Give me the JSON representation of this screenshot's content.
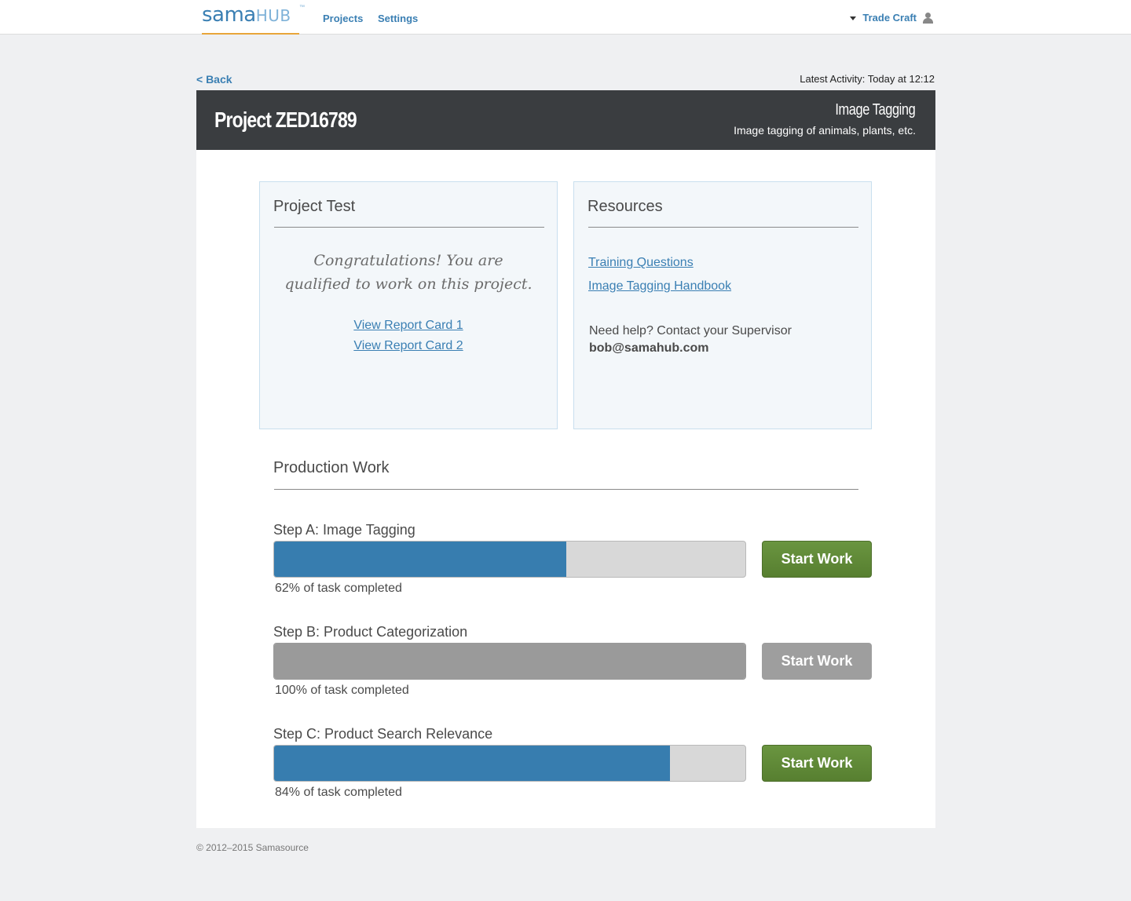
{
  "nav": {
    "logo_sama": "sama",
    "logo_hub": "HUB",
    "logo_tm": "™",
    "projects": "Projects",
    "settings": "Settings",
    "user": "Trade Craft"
  },
  "subheader": {
    "back": "< Back",
    "latest_activity": "Latest Activity: Today at 12:12"
  },
  "banner": {
    "title": "Project ZED16789",
    "type": "Image Tagging",
    "description": "Image tagging of animals, plants, etc."
  },
  "project_test": {
    "heading": "Project Test",
    "message_line1": "Congratulations! You are",
    "message_line2": "qualified to work on this project.",
    "report_links": [
      "View Report Card 1",
      "View Report Card 2"
    ]
  },
  "resources": {
    "heading": "Resources",
    "links": [
      "Training Questions",
      "Image Tagging Handbook"
    ],
    "help_text": "Need help? Contact your Supervisor",
    "email": "bob@samahub.com"
  },
  "production": {
    "heading": "Production Work",
    "steps": [
      {
        "label": "Step A: Image Tagging",
        "progress": 62,
        "progress_text": "62% of task completed",
        "button": "Start Work",
        "enabled": true
      },
      {
        "label": "Step B: Product Categorization",
        "progress": 100,
        "progress_text": "100% of task completed",
        "button": "Start Work",
        "enabled": false
      },
      {
        "label": "Step C: Product Search Relevance",
        "progress": 84,
        "progress_text": "84% of task completed",
        "button": "Start Work",
        "enabled": true
      }
    ]
  },
  "colors": {
    "brand_blue": "#3a7fb3",
    "progress_blue": "#377daf",
    "button_green": "#5f8a36",
    "disabled_gray": "#9e9e9e",
    "banner_dark": "#3a3d40",
    "logo_underline": "#e8a53a"
  },
  "icons": {
    "user_menu_caret": "caret-down-icon",
    "user_avatar": "user-icon"
  },
  "footer": "© 2012–2015 Samasource"
}
